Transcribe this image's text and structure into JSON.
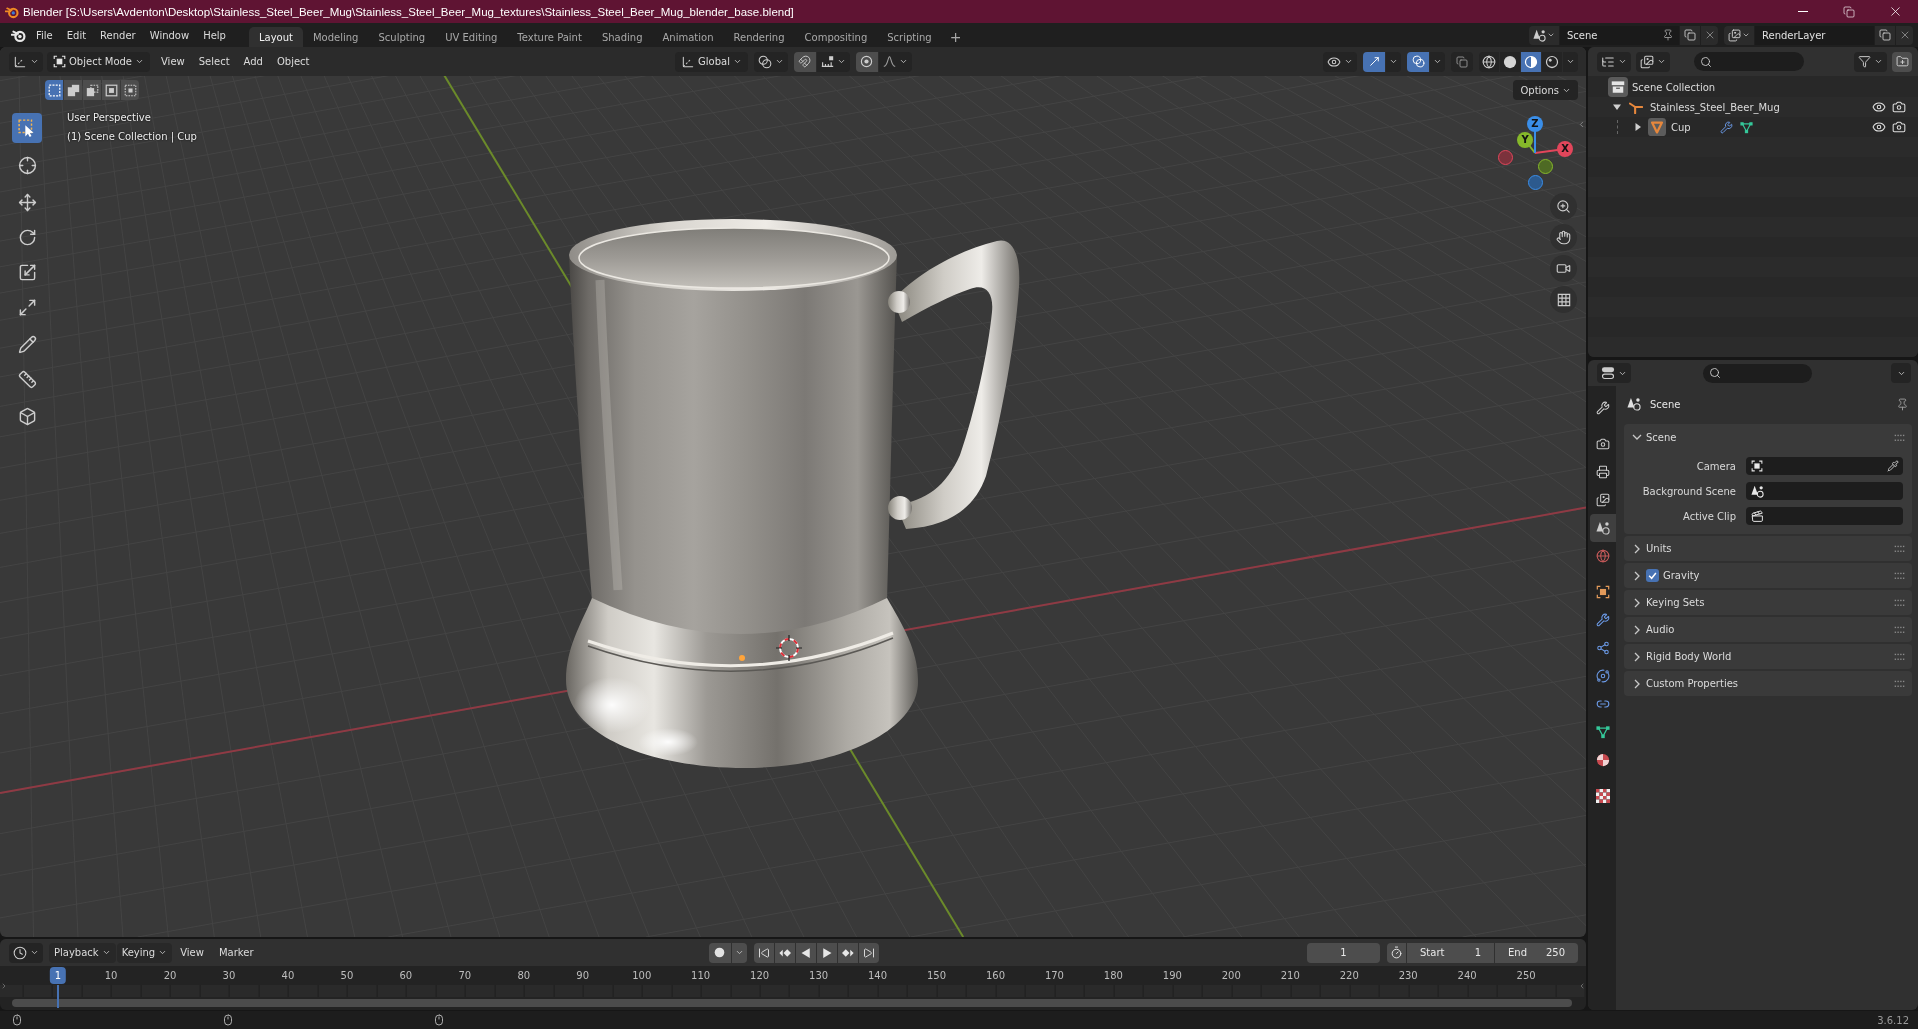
{
  "window": {
    "title": "Blender [S:\\Users\\Avdenton\\Desktop\\Stainless_Steel_Beer_Mug\\Stainless_Steel_Beer_Mug_textures\\Stainless_Steel_Beer_Mug_blender_base.blend]"
  },
  "menu": [
    "File",
    "Edit",
    "Render",
    "Window",
    "Help"
  ],
  "workspaces": [
    {
      "label": "Layout",
      "selected": true
    },
    {
      "label": "Modeling",
      "selected": false
    },
    {
      "label": "Sculpting",
      "selected": false
    },
    {
      "label": "UV Editing",
      "selected": false
    },
    {
      "label": "Texture Paint",
      "selected": false
    },
    {
      "label": "Shading",
      "selected": false
    },
    {
      "label": "Animation",
      "selected": false
    },
    {
      "label": "Rendering",
      "selected": false
    },
    {
      "label": "Compositing",
      "selected": false
    },
    {
      "label": "Scripting",
      "selected": false
    }
  ],
  "add_workspace": "+",
  "scene": "Scene",
  "view_layer": "RenderLayer",
  "viewport": {
    "mode": "Object Mode",
    "menus": [
      "View",
      "Select",
      "Add",
      "Object"
    ],
    "orientation": "Global",
    "toggles": [
      {
        "kind": "gizmos",
        "on": true
      },
      {
        "kind": "overlays",
        "on": true
      },
      {
        "kind": "xray",
        "on": false
      }
    ],
    "shading": [
      {
        "kind": "wireframe",
        "selected": false
      },
      {
        "kind": "solid",
        "selected": false
      },
      {
        "kind": "material",
        "selected": true
      },
      {
        "kind": "rendered",
        "selected": false
      }
    ],
    "select_modes": [
      {
        "kind": "set",
        "selected": true
      },
      {
        "kind": "extend",
        "selected": false
      },
      {
        "kind": "subtract",
        "selected": false
      },
      {
        "kind": "difference",
        "selected": false
      },
      {
        "kind": "intersect",
        "selected": false
      }
    ],
    "options": "Options",
    "view_name": "User Perspective",
    "context": "(1) Scene Collection | Cup",
    "tool_groups": [
      {
        "tools": [
          {
            "kind": "select_box",
            "selected": true
          }
        ]
      },
      {
        "tools": [
          {
            "kind": "cursor",
            "selected": false
          }
        ]
      },
      {
        "tools": [
          {
            "kind": "move",
            "selected": false
          },
          {
            "kind": "rotate",
            "selected": false
          },
          {
            "kind": "scale",
            "selected": false
          },
          {
            "kind": "transform",
            "selected": false
          }
        ]
      },
      {
        "tools": [
          {
            "kind": "annotate",
            "selected": false
          },
          {
            "kind": "measure",
            "selected": false
          }
        ]
      },
      {
        "tools": [
          {
            "kind": "add_cube",
            "selected": false
          }
        ]
      }
    ],
    "gizmo_axes": [
      {
        "label": "X",
        "color": "#e2465b"
      },
      {
        "label": "Y",
        "color": "#86b82a"
      },
      {
        "label": "Z",
        "color": "#3a8ee8"
      }
    ]
  },
  "outliner": {
    "root": "Scene Collection",
    "items": [
      {
        "name": "Stainless_Steel_Beer_Mug",
        "kind": "empty",
        "expanded": true,
        "children": [
          {
            "name": "Cup",
            "kind": "mesh",
            "expanded": false,
            "extras": [
              {
                "kind": "modifier"
              },
              {
                "kind": "mesh_data"
              }
            ]
          }
        ]
      }
    ]
  },
  "properties": {
    "tab_groups": [
      {
        "tabs": [
          {
            "kind": "tool",
            "selected": false
          }
        ]
      },
      {
        "tabs": [
          {
            "kind": "render",
            "selected": false
          },
          {
            "kind": "output",
            "selected": false
          },
          {
            "kind": "view_layer",
            "selected": false
          },
          {
            "kind": "scene",
            "selected": true
          },
          {
            "kind": "world",
            "selected": false
          }
        ]
      },
      {
        "tabs": [
          {
            "kind": "object",
            "selected": false
          },
          {
            "kind": "modifiers",
            "selected": false
          },
          {
            "kind": "particles",
            "selected": false
          },
          {
            "kind": "physics",
            "selected": false
          },
          {
            "kind": "constraints",
            "selected": false
          },
          {
            "kind": "data",
            "selected": false
          },
          {
            "kind": "material",
            "selected": false
          }
        ]
      },
      {
        "tabs": [
          {
            "kind": "texture",
            "selected": false
          }
        ]
      }
    ],
    "context": "Scene",
    "panels": [
      {
        "title": "Scene",
        "expanded": true,
        "fields": [
          {
            "label": "Camera",
            "kind": "camera"
          },
          {
            "label": "Background Scene",
            "kind": "scene"
          },
          {
            "label": "Active Clip",
            "kind": "clip"
          }
        ]
      },
      {
        "title": "Units",
        "expanded": false
      },
      {
        "title": "Gravity",
        "expanded": false,
        "checked": true
      },
      {
        "title": "Keying Sets",
        "expanded": false
      },
      {
        "title": "Audio",
        "expanded": false
      },
      {
        "title": "Rigid Body World",
        "expanded": false
      },
      {
        "title": "Custom Properties",
        "expanded": false
      }
    ]
  },
  "timeline": {
    "menus": [
      {
        "label": "Playback",
        "kind": "dropdown"
      },
      {
        "label": "Keying",
        "kind": "dropdown"
      },
      {
        "label": "View",
        "kind": "menu"
      },
      {
        "label": "Marker",
        "kind": "menu"
      }
    ],
    "current_frame": "1",
    "start_label": "Start",
    "start": "1",
    "end_label": "End",
    "end": "250",
    "ruler": [
      {
        "label": "1",
        "selected": true
      },
      {
        "label": "10",
        "selected": false
      },
      {
        "label": "20",
        "selected": false
      },
      {
        "label": "30",
        "selected": false
      },
      {
        "label": "40",
        "selected": false
      },
      {
        "label": "50",
        "selected": false
      },
      {
        "label": "60",
        "selected": false
      },
      {
        "label": "70",
        "selected": false
      },
      {
        "label": "80",
        "selected": false
      },
      {
        "label": "90",
        "selected": false
      },
      {
        "label": "100",
        "selected": false
      },
      {
        "label": "110",
        "selected": false
      },
      {
        "label": "120",
        "selected": false
      },
      {
        "label": "130",
        "selected": false
      },
      {
        "label": "140",
        "selected": false
      },
      {
        "label": "150",
        "selected": false
      },
      {
        "label": "160",
        "selected": false
      },
      {
        "label": "170",
        "selected": false
      },
      {
        "label": "180",
        "selected": false
      },
      {
        "label": "190",
        "selected": false
      },
      {
        "label": "200",
        "selected": false
      },
      {
        "label": "210",
        "selected": false
      },
      {
        "label": "220",
        "selected": false
      },
      {
        "label": "230",
        "selected": false
      },
      {
        "label": "240",
        "selected": false
      },
      {
        "label": "250",
        "selected": false
      }
    ]
  },
  "status_bar": {
    "version": "3.6.12"
  }
}
